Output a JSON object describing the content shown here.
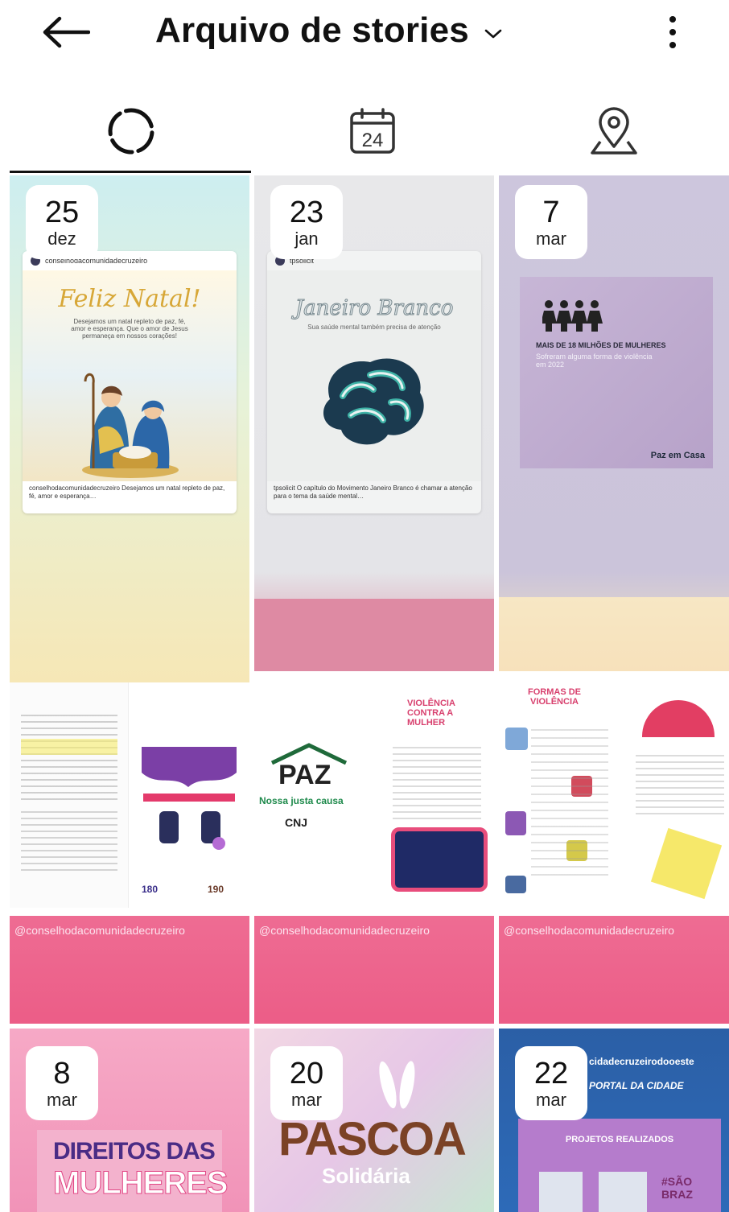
{
  "header": {
    "title": "Arquivo de stories"
  },
  "tabs": [
    {
      "name": "stories-tab",
      "icon": "dashed-circle-icon",
      "selected": true
    },
    {
      "name": "calendar-tab",
      "icon": "calendar-icon",
      "calendar_number": "24",
      "selected": false
    },
    {
      "name": "location-tab",
      "icon": "map-pin-icon",
      "selected": false
    }
  ],
  "stories": [
    {
      "day": "25",
      "month": "dez",
      "post_title": "Feliz Natal!",
      "post_text": "Desejamos um natal repleto de paz, fé, amor e esperança. Que o amor de Jesus permaneça em nossos corações!"
    },
    {
      "day": "23",
      "month": "jan",
      "post_title": "Janeiro Branco",
      "post_text": "Sua saúde mental também precisa de atenção"
    },
    {
      "day": "7",
      "month": "mar",
      "post_title": "MAIS DE 18 MILHÕES DE MULHERES",
      "post_text": "Sofreram alguma forma de violência em 2022",
      "brand": "Paz em Casa"
    },
    {
      "handle": "@conselhodacomunidadecruzeiro",
      "badge": "180",
      "badge2": "190"
    },
    {
      "handle": "@conselhodacomunidadecruzeiro",
      "logo_text": "PAZ",
      "slogan": "Nossa justa causa",
      "org": "CNJ",
      "headline": "VIOLÊNCIA CONTRA A MULHER"
    },
    {
      "handle": "@conselhodacomunidadecruzeiro",
      "headline": "FORMAS DE VIOLÊNCIA"
    },
    {
      "day": "8",
      "month": "mar",
      "post_title_1": "DIREITOS DAS",
      "post_title_2": "MULHERES"
    },
    {
      "day": "20",
      "month": "mar",
      "post_title_1": "PASCOA",
      "post_title_2": "Solidária"
    },
    {
      "day": "22",
      "month": "mar",
      "account": "cidadecruzeirodooeste",
      "brand": "PORTAL DA CIDADE",
      "post_title": "PROJETOS REALIZADOS",
      "hashtag": "#SÃO BRAZ"
    }
  ],
  "colors": {
    "accent_pink": "#ea5a87",
    "indicator": "#111111"
  }
}
